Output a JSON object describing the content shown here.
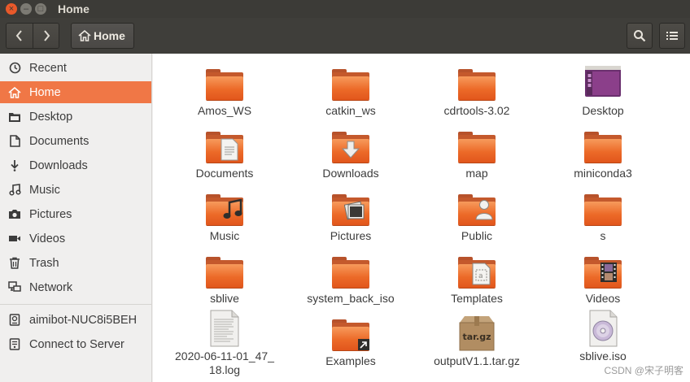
{
  "window": {
    "title": "Home"
  },
  "toolbar": {
    "back_label": "‹",
    "forward_label": "›",
    "path_label": "Home"
  },
  "sidebar": {
    "items": [
      {
        "label": "Recent",
        "icon": "clock-icon"
      },
      {
        "label": "Home",
        "icon": "home-icon",
        "active": true
      },
      {
        "label": "Desktop",
        "icon": "desktop-folder-icon"
      },
      {
        "label": "Documents",
        "icon": "document-icon"
      },
      {
        "label": "Downloads",
        "icon": "download-arrow-icon"
      },
      {
        "label": "Music",
        "icon": "music-note-icon"
      },
      {
        "label": "Pictures",
        "icon": "camera-icon"
      },
      {
        "label": "Videos",
        "icon": "video-camera-icon"
      },
      {
        "label": "Trash",
        "icon": "trash-icon"
      },
      {
        "label": "Network",
        "icon": "network-icon"
      },
      {
        "label": "aimibot-NUC8i5BEH",
        "icon": "drive-icon"
      },
      {
        "label": "Connect to Server",
        "icon": "server-icon"
      }
    ]
  },
  "files": [
    {
      "name": "Amos_WS",
      "type": "folder"
    },
    {
      "name": "catkin_ws",
      "type": "folder"
    },
    {
      "name": "cdrtools-3.02",
      "type": "folder"
    },
    {
      "name": "Desktop",
      "type": "desktop-folder"
    },
    {
      "name": "Documents",
      "type": "folder-documents"
    },
    {
      "name": "Downloads",
      "type": "folder-downloads"
    },
    {
      "name": "map",
      "type": "folder"
    },
    {
      "name": "miniconda3",
      "type": "folder"
    },
    {
      "name": "Music",
      "type": "folder-music"
    },
    {
      "name": "Pictures",
      "type": "folder-pictures"
    },
    {
      "name": "Public",
      "type": "folder-public"
    },
    {
      "name": "s",
      "type": "folder"
    },
    {
      "name": "sblive",
      "type": "folder"
    },
    {
      "name": "system_back_iso",
      "type": "folder"
    },
    {
      "name": "Templates",
      "type": "folder-templates"
    },
    {
      "name": "Videos",
      "type": "folder-videos"
    },
    {
      "name": "2020-06-11-01_47_18.log",
      "display": [
        "2020-06-11-01_47_",
        "18.log"
      ],
      "type": "text-file"
    },
    {
      "name": "Examples",
      "type": "folder-link"
    },
    {
      "name": "outputV1.1.tar.gz",
      "type": "archive",
      "badge": "tar.gz"
    },
    {
      "name": "sblive.iso",
      "type": "iso"
    }
  ],
  "watermark": "CSDN @宋子明客",
  "colors": {
    "accent": "#f07746",
    "titlebar": "#3c3b37",
    "folder": "#ec6a28"
  }
}
